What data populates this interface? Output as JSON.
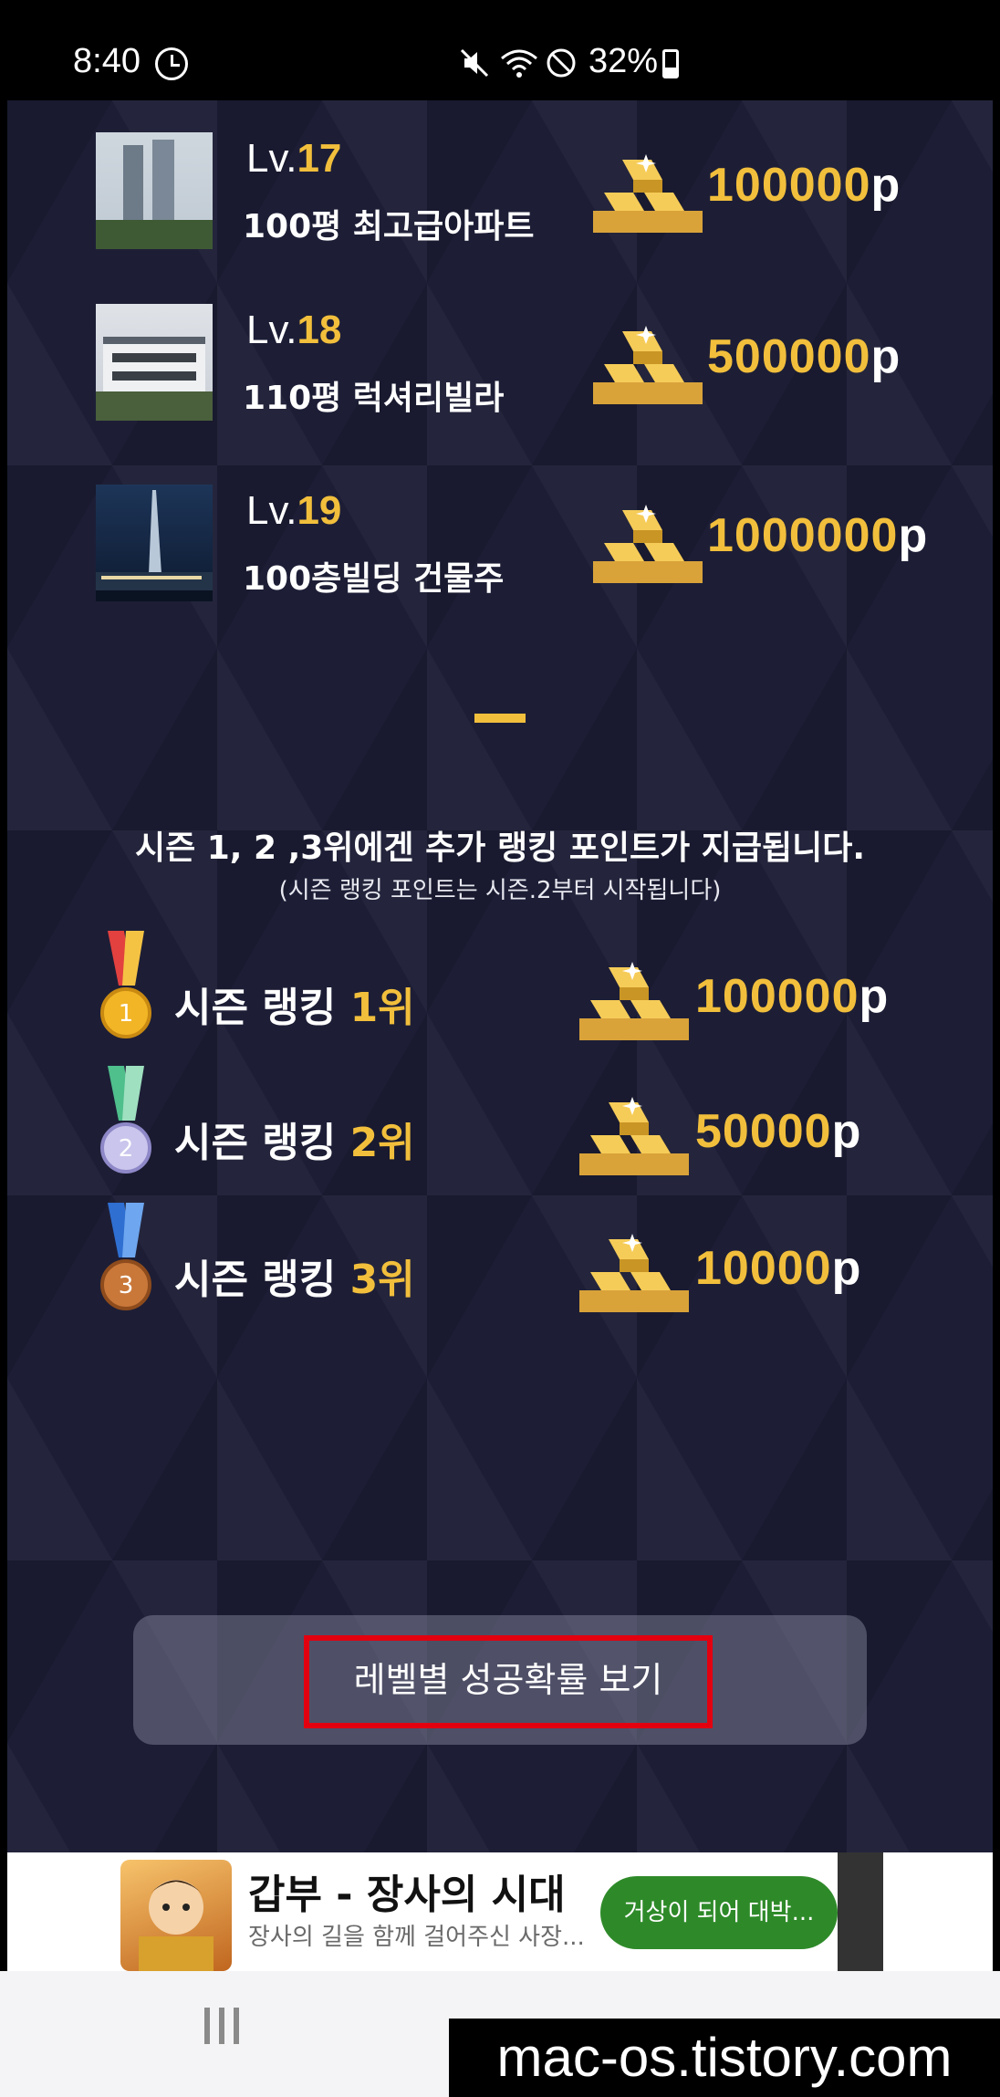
{
  "status_bar": {
    "time": "8:40",
    "battery": "32%"
  },
  "levels": [
    {
      "lv_prefix": "Lv.",
      "lv_num": "17",
      "name": "100평 최고급아파트",
      "reward_value": "100000",
      "unit": "p",
      "image": "apartment-photo"
    },
    {
      "lv_prefix": "Lv.",
      "lv_num": "18",
      "name": "110평 럭셔리빌라",
      "reward_value": "500000",
      "unit": "p",
      "image": "villa-photo"
    },
    {
      "lv_prefix": "Lv.",
      "lv_num": "19",
      "name": "100층빌딩 건물주",
      "reward_value": "1000000",
      "unit": "p",
      "image": "tower-photo"
    }
  ],
  "notice": {
    "title": "시즌 1, 2 ,3위에겐 추가 랭킹 포인트가 지급됩니다.",
    "subtitle": "(시즌 랭킹 포인트는 시즌.2부터 시작됩니다)"
  },
  "ranks": [
    {
      "label": "시즌 랭킹 ",
      "place": "1위",
      "reward_value": "100000",
      "unit": "p",
      "medal": "gold-medal-icon"
    },
    {
      "label": "시즌 랭킹 ",
      "place": "2위",
      "reward_value": "50000",
      "unit": "p",
      "medal": "silver-medal-icon"
    },
    {
      "label": "시즌 랭킹 ",
      "place": "3위",
      "reward_value": "10000",
      "unit": "p",
      "medal": "bronze-medal-icon"
    }
  ],
  "success_rate_button": {
    "label": "레벨별 성공확률 보기"
  },
  "ad": {
    "title": "갑부 - 장사의 시대",
    "description": "장사의 길을 함께 걸어주신 사장...",
    "cta": "거상이 되어 대박..."
  },
  "watermark": "mac-os.tistory.com",
  "colors": {
    "accent_gold": "#f2bf3c",
    "background": "#1d1e36",
    "highlight_red": "#e3000f",
    "ad_cta_green": "#2e8a29"
  }
}
